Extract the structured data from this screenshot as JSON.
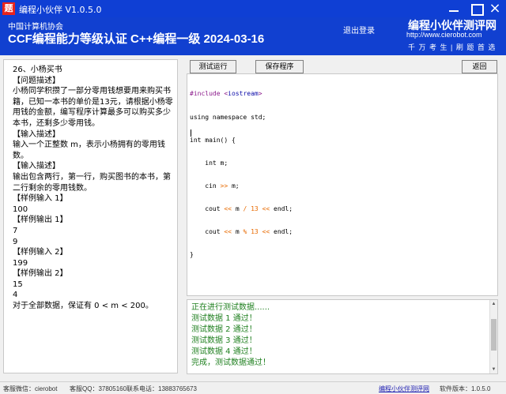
{
  "window": {
    "title": "编程小伙伴 V1.0.5.0",
    "icon_text": "题"
  },
  "header": {
    "org": "中国计算机协会",
    "exam_title": "CCF编程能力等级认证 C++编程一级 2024-03-16",
    "logout_label": "退出登录",
    "brand": "编程小伙伴测评网",
    "url": "http://www.cierobot.com",
    "slogan": "千 万 考 生 | 刷 题 首 选"
  },
  "toolbar": {
    "run_label": "测试运行",
    "save_label": "保存程序",
    "back_label": "返回"
  },
  "problem": {
    "lines": [
      "26、小杨买书",
      "【问题描述】",
      "小杨同学积攒了一部分零用钱想要用来购买书籍，已知一本书的单价是13元，请根据小杨零用钱的金额，编写程序计算最多可以购买多少本书，还剩多少零用钱。",
      "【输入描述】",
      "输入一个正整数 m，表示小杨拥有的零用钱数。",
      "【输入描述】",
      "输出包含两行，第一行，购买图书的本书，第二行剩余的零用钱数。",
      "【样例输入 1】",
      "100",
      "【样例输出 1】",
      "7",
      "9",
      "【样例输入 2】",
      "199",
      "【样例输出 2】",
      "15",
      "4",
      "对于全部数据，保证有 0 < m < 200。"
    ]
  },
  "editor": {
    "code_lines": [
      "#include <iostream>",
      "using namespace std;",
      "int main() {",
      "    int m;",
      "    cin >> m;",
      "    cout << m / 13 << endl;",
      "    cout << m % 13 << endl;",
      "}"
    ]
  },
  "results": {
    "lines": [
      "正在进行测试数据......",
      "测试数据 1 通过！",
      "测试数据 2 通过！",
      "测试数据 3 通过！",
      "测试数据 4 通过！",
      "完成，测试数据通过！"
    ]
  },
  "statusbar": {
    "service": "客服微信：cierobot",
    "qq": "客服QQ：37805160",
    "phone": "联系电话：13883765673",
    "site_link": "编程小伙伴测评网",
    "version": "软件版本：1.0.5.0"
  },
  "colors": {
    "title_bar": "#0f3fd4",
    "header_bg": "#1140d0",
    "result_text": "#208020",
    "code_keyword": "#8b1a8b",
    "code_operator": "#e86a00"
  }
}
